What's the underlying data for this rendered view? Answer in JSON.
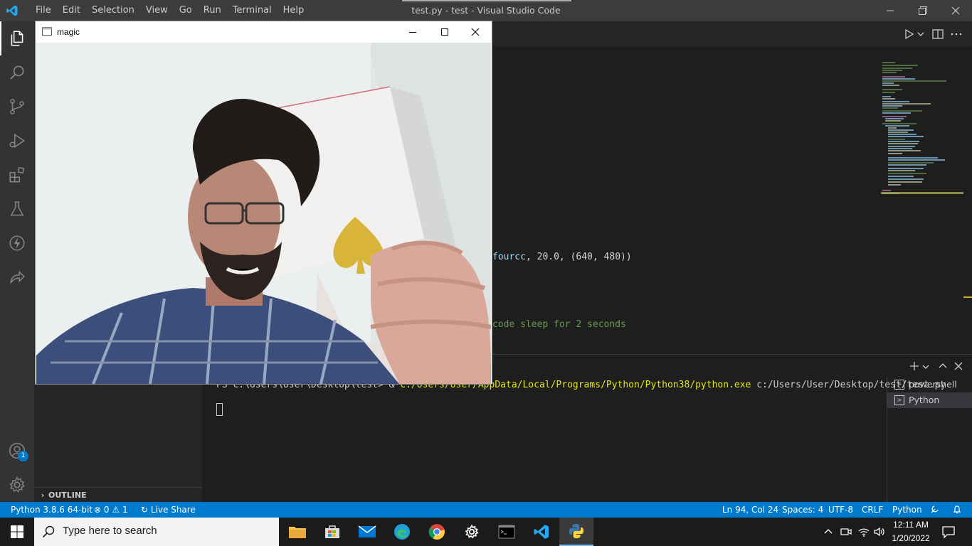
{
  "menu": [
    "File",
    "Edit",
    "Selection",
    "View",
    "Go",
    "Run",
    "Terminal",
    "Help"
  ],
  "window_title": "test.py - test - Visual Studio Code",
  "window_controls": {
    "minimize": "—",
    "restore": "❐",
    "close": "✕"
  },
  "editor": {
    "line1": {
      "param": "fourcc",
      "rest": ", 20.0, (640, 480))"
    },
    "line2": "code sleep for 2 seconds"
  },
  "outline_label": "OUTLINE",
  "terminal": {
    "prompt": "PS C:\\Users\\User\\Desktop\\test> & ",
    "exe": "C:/Users/User/AppData/Local/Programs/Python/Python38/python.exe",
    "arg": " c:/Users/User/Desktop/test/test.py",
    "sessions": [
      "powershell",
      "Python"
    ],
    "selected_session": "Python"
  },
  "accounts_badge": "1",
  "status": {
    "interpreter": "Python 3.8.6 64-bit",
    "errors": "0",
    "warnings": "1",
    "live_share": "Live Share",
    "position": "Ln 94, Col 24",
    "spaces": "Spaces: 4",
    "encoding": "UTF-8",
    "eol": "CRLF",
    "language": "Python"
  },
  "magic_window": {
    "title": "magic"
  },
  "taskbar": {
    "search_placeholder": "Type here to search",
    "time": "12:11 AM",
    "date": "1/20/2022"
  },
  "colors": {
    "accent": "#007acc",
    "string_yellow": "#dcdcaa",
    "comment_green": "#6a9955",
    "number_green": "#b5cea8",
    "param_blue": "#9cdcfe"
  }
}
